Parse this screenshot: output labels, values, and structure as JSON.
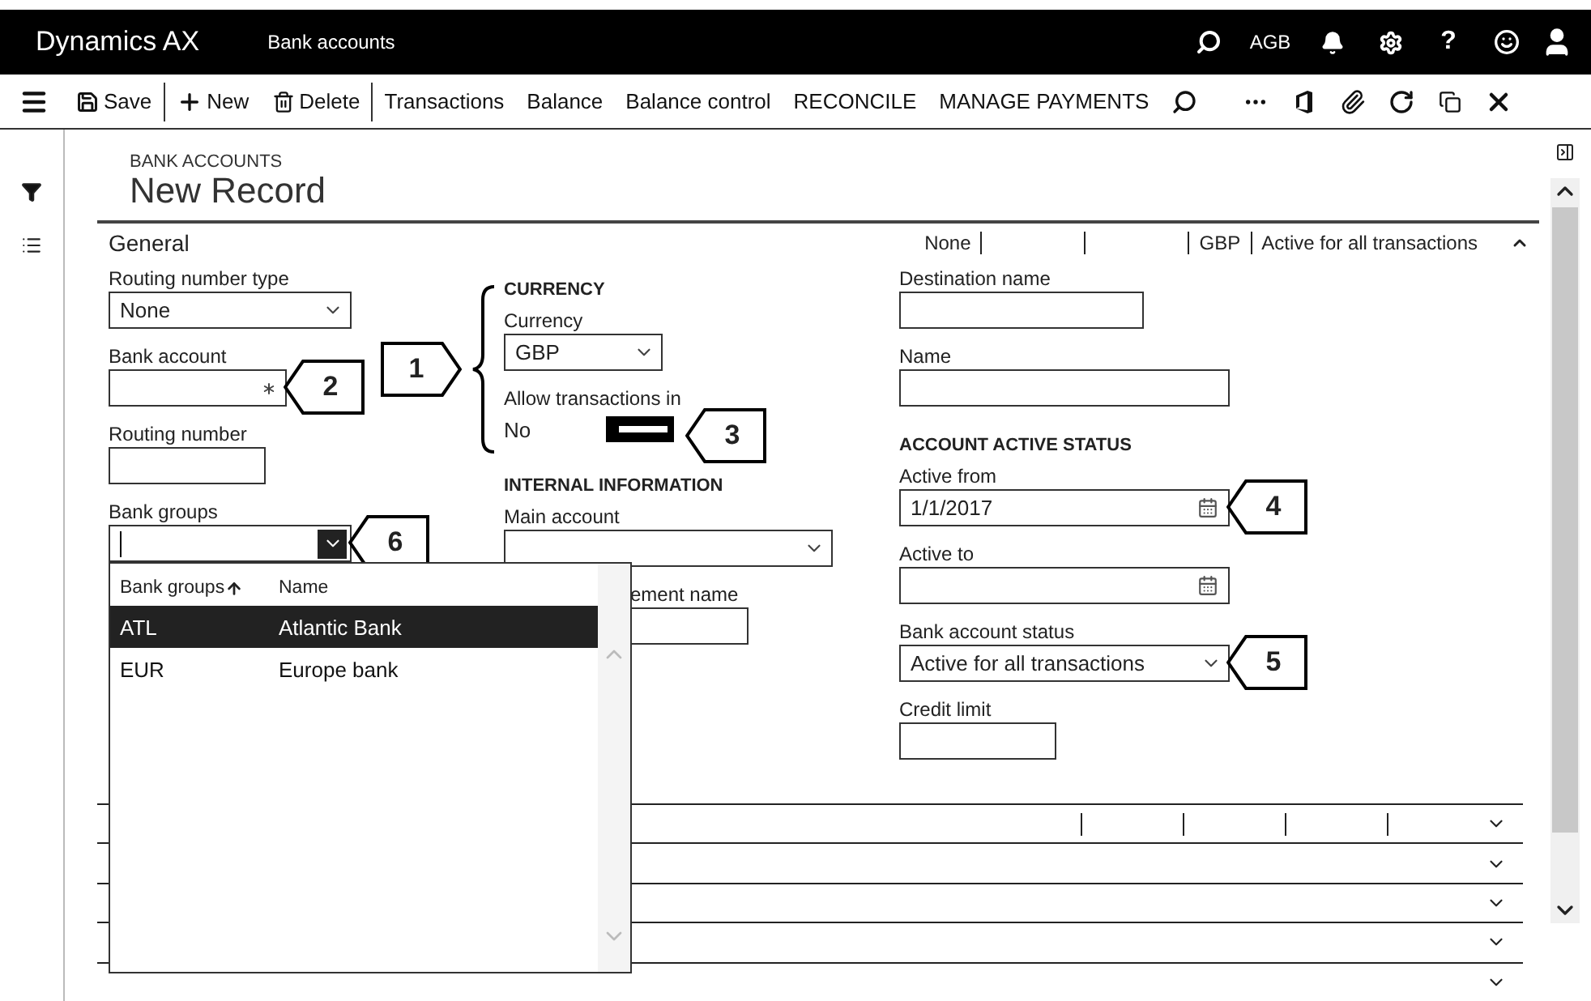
{
  "top_bar": {
    "app_title": "Dynamics AX",
    "module": "Bank accounts",
    "company": "AGB",
    "help": "?"
  },
  "action_bar": [
    {
      "kind": "save",
      "label": "Save"
    },
    {
      "kind": "separator"
    },
    {
      "kind": "new",
      "label": "New"
    },
    {
      "kind": "delete",
      "label": "Delete"
    },
    {
      "kind": "separator"
    },
    {
      "kind": "text",
      "label": "Transactions"
    },
    {
      "kind": "text",
      "label": "Balance"
    },
    {
      "kind": "text",
      "label": "Balance control"
    },
    {
      "kind": "text",
      "label": "RECONCILE"
    },
    {
      "kind": "text",
      "label": "MANAGE PAYMENTS"
    },
    {
      "kind": "search"
    },
    {
      "kind": "more"
    },
    {
      "kind": "office"
    },
    {
      "kind": "attach"
    },
    {
      "kind": "refresh"
    },
    {
      "kind": "popout"
    },
    {
      "kind": "close"
    }
  ],
  "page": {
    "breadcrumb": "BANK ACCOUNTS",
    "title": "New Record"
  },
  "general": {
    "title": "General",
    "expanded": true,
    "summary": [
      {
        "text": "None"
      },
      {
        "blank": true
      },
      {
        "blank": true
      },
      {
        "text": "GBP"
      },
      {
        "text": "Active for all transactions"
      }
    ],
    "columns": [
      {
        "items": [
          {
            "kind": "select",
            "label": "Routing number type",
            "value": "None"
          },
          {
            "kind": "text",
            "label": "Bank account",
            "required": true,
            "callout": "2"
          },
          {
            "kind": "text",
            "label": "Routing number"
          },
          {
            "kind": "select",
            "label": "Bank groups",
            "focused": true,
            "callout": "6"
          }
        ]
      },
      {
        "bracket_callout": "1",
        "items": [
          {
            "kind": "heading",
            "label": "CURRENCY"
          },
          {
            "kind": "select",
            "label": "Currency",
            "value": "GBP"
          },
          {
            "kind": "toggle",
            "label": "Allow transactions in",
            "value": "No",
            "on": false,
            "callout": "3"
          },
          {
            "kind": "heading",
            "label": "INTERNAL INFORMATION"
          },
          {
            "kind": "select",
            "label": "Main account"
          },
          {
            "kind": "text",
            "label": "ement name"
          }
        ]
      },
      {
        "items": [
          {
            "kind": "text",
            "label": "Destination name"
          },
          {
            "kind": "text",
            "label": "Name"
          },
          {
            "kind": "heading",
            "label": "ACCOUNT ACTIVE STATUS"
          },
          {
            "kind": "date",
            "label": "Active from",
            "value": "1/1/2017",
            "callout": "4"
          },
          {
            "kind": "date",
            "label": "Active to"
          },
          {
            "kind": "select",
            "label": "Bank account status",
            "value": "Active for all transactions",
            "callout": "5"
          },
          {
            "kind": "text",
            "label": "Credit limit"
          }
        ]
      }
    ]
  },
  "lookup": {
    "columns": [
      "Bank groups",
      "Name"
    ],
    "rows": [
      {
        "code": "ATL",
        "name": "Atlantic Bank",
        "selected": true
      },
      {
        "code": "EUR",
        "name": "Europe bank",
        "selected": false
      }
    ]
  },
  "collapsed_sections": [
    {
      "expanded": false,
      "summary": [
        {
          "blank": true
        },
        {
          "blank": true
        },
        {
          "blank": true
        },
        {
          "blank": true
        }
      ]
    },
    {
      "expanded": false
    },
    {
      "expanded": false
    },
    {
      "expanded": false
    },
    {
      "expanded": false
    }
  ]
}
